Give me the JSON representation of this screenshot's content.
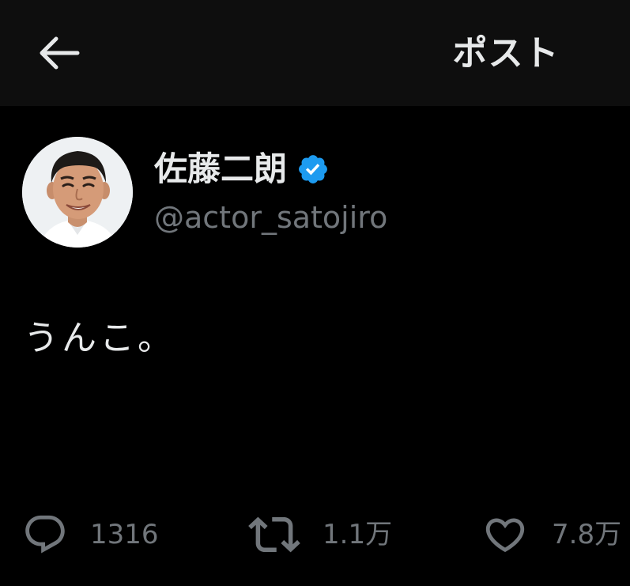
{
  "header": {
    "back_icon": "arrow-left-icon",
    "title": "ポスト"
  },
  "tweet": {
    "author": {
      "display_name": "佐藤二朗",
      "handle": "@actor_satojiro",
      "verified": true,
      "verified_color": "#1d9bf0"
    },
    "text": "うんこ。",
    "metrics": {
      "replies": "1316",
      "retweets": "1.1万",
      "likes": "7.8万"
    }
  },
  "colors": {
    "background": "#000000",
    "header_background": "#0e0e0e",
    "primary_text": "#e7e9ea",
    "secondary_text": "#71767b"
  }
}
